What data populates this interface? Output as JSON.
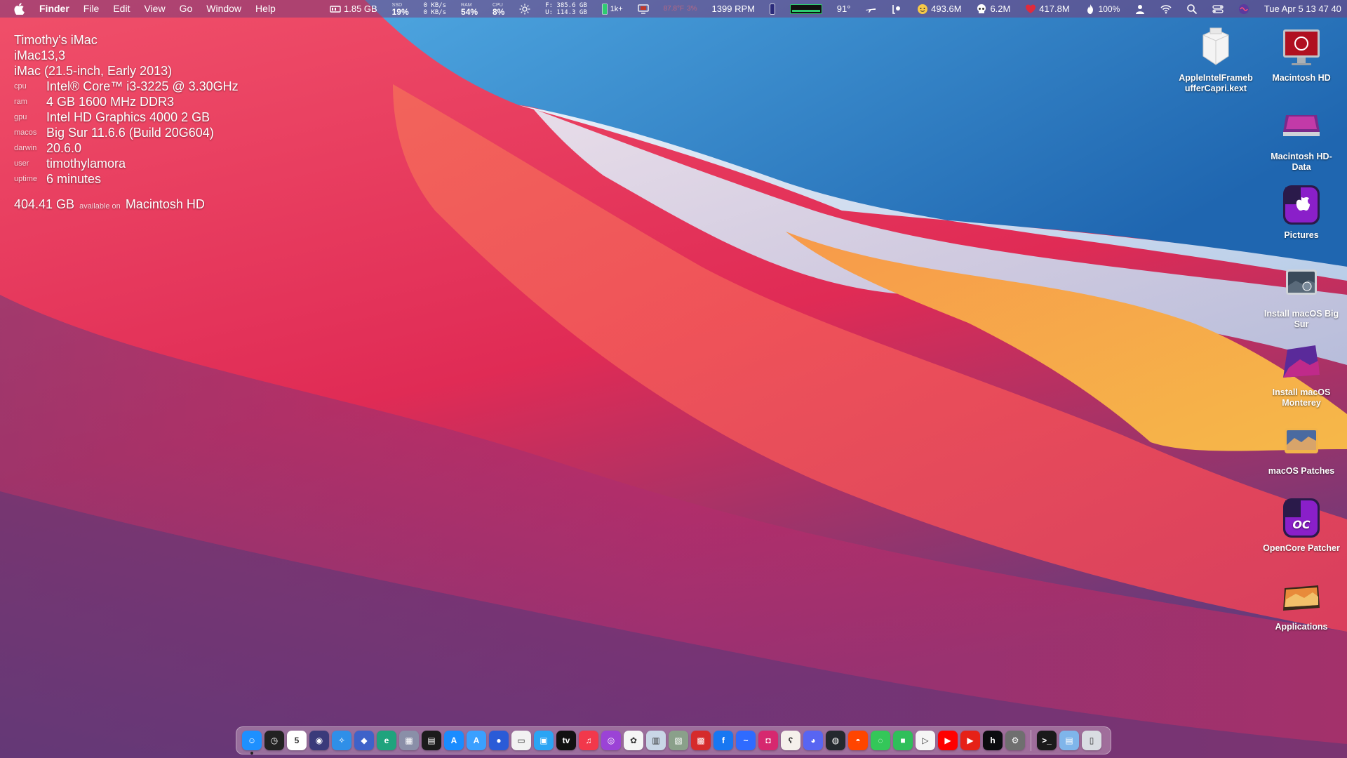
{
  "menubar": {
    "app_name": "Finder",
    "menus": [
      "File",
      "Edit",
      "View",
      "Go",
      "Window",
      "Help"
    ],
    "memory_free": "1.85 GB",
    "ssd_label": "SSD",
    "ssd_value": "19%",
    "net_up": "0 KB/s",
    "net_down": "0 KB/s",
    "ram_label": "RAM",
    "ram_value": "54%",
    "cpu_label": "CPU",
    "cpu_value": "8%",
    "disk_free": "F: 385.6 GB",
    "disk_used": "U: 114.3 GB",
    "battery_badge": "1k+",
    "temp_reading": "87.8°F",
    "temp_pct": "3%",
    "fan_speed": "1399 RPM",
    "temperature": "91°",
    "stat_a": "493.6M",
    "stat_b": "6.2M",
    "stat_c": "417.8M",
    "battery_pct": "100%",
    "clock": "Tue Apr 5  13 47 40",
    "accent_color": "#2ecc71"
  },
  "sysinfo": {
    "name": "Timothy's iMac",
    "model_id": "iMac13,3",
    "model": "iMac (21.5-inch, Early 2013)",
    "rows": [
      {
        "key": "cpu",
        "value": "Intel® Core™ i3-3225 @ 3.30GHz"
      },
      {
        "key": "ram",
        "value": "4 GB 1600 MHz DDR3"
      },
      {
        "key": "gpu",
        "value": "Intel HD Graphics 4000 2 GB"
      },
      {
        "key": "macos",
        "value": "Big Sur 11.6.6 (Build 20G604)"
      },
      {
        "key": "darwin",
        "value": "20.6.0"
      },
      {
        "key": "user",
        "value": "timothylamora"
      },
      {
        "key": "uptime",
        "value": "6 minutes"
      }
    ],
    "disk_amount": "404.41 GB",
    "disk_mid": "available on",
    "disk_name": "Macintosh HD"
  },
  "desktop_icons": [
    {
      "label": "AppleIntelFramebufferCapri.kext",
      "icon": "kext-icon"
    },
    {
      "label": "Macintosh HD",
      "icon": "hard-drive-icon"
    },
    {
      "label": "Macintosh HD-Data",
      "icon": "data-drive-icon"
    },
    {
      "label": "Pictures",
      "icon": "pictures-icon"
    },
    {
      "label": "Install macOS Big Sur",
      "icon": "installer-bigsur-icon"
    },
    {
      "label": "Install macOS Monterey",
      "icon": "installer-monterey-icon"
    },
    {
      "label": "macOS Patches",
      "icon": "patches-icon"
    },
    {
      "label": "OpenCore Patcher",
      "icon": "opencore-icon"
    },
    {
      "label": "Applications",
      "icon": "applications-icon"
    }
  ],
  "dock": {
    "apps": [
      {
        "name": "finder-icon",
        "color": "#1e90ff",
        "glyph": "☺"
      },
      {
        "name": "clock-icon",
        "color": "#222222",
        "glyph": "◷"
      },
      {
        "name": "calendar-icon",
        "color": "#ffffff",
        "glyph": "5"
      },
      {
        "name": "siri-icon",
        "color": "#3a3a7a",
        "glyph": "◉"
      },
      {
        "name": "safari-icon",
        "color": "#2f8fe8",
        "glyph": "✧"
      },
      {
        "name": "utility-icon",
        "color": "#3e62c9",
        "glyph": "◆"
      },
      {
        "name": "edge-icon",
        "color": "#1fa37d",
        "glyph": "e"
      },
      {
        "name": "launchpad-icon",
        "color": "#8a8fa8",
        "glyph": "▦"
      },
      {
        "name": "widgets-icon",
        "color": "#1b1b1b",
        "glyph": "▤"
      },
      {
        "name": "app-store-icon",
        "color": "#1a8cff",
        "glyph": "A"
      },
      {
        "name": "xcode-icon",
        "color": "#3aa0ff",
        "glyph": "A"
      },
      {
        "name": "feedback-icon",
        "color": "#2a5bd7",
        "glyph": "●"
      },
      {
        "name": "apple-card-icon",
        "color": "#f2f2f2",
        "glyph": "▭"
      },
      {
        "name": "screen-icon",
        "color": "#2aa4f4",
        "glyph": "▣"
      },
      {
        "name": "apple-tv-icon",
        "color": "#111111",
        "glyph": "tv"
      },
      {
        "name": "music-icon",
        "color": "#f2384b",
        "glyph": "♫"
      },
      {
        "name": "podcasts-icon",
        "color": "#9b43d6",
        "glyph": "◎"
      },
      {
        "name": "photos-icon",
        "color": "#f5f5f5",
        "glyph": "✿"
      },
      {
        "name": "preview-icon",
        "color": "#c9d6e6",
        "glyph": "▥"
      },
      {
        "name": "image-capture-icon",
        "color": "#8aa08a",
        "glyph": "▧"
      },
      {
        "name": "photo-booth-icon",
        "color": "#d52b2b",
        "glyph": "▩"
      },
      {
        "name": "facebook-icon",
        "color": "#1877f2",
        "glyph": "f"
      },
      {
        "name": "messenger-icon",
        "color": "#2f6bff",
        "glyph": "~"
      },
      {
        "name": "instagram-icon",
        "color": "#d6286f",
        "glyph": "◘"
      },
      {
        "name": "bear-icon",
        "color": "#f5f0eb",
        "glyph": "ʕ"
      },
      {
        "name": "discord-icon",
        "color": "#5865f2",
        "glyph": "◕"
      },
      {
        "name": "github-icon",
        "color": "#24292e",
        "glyph": "◍"
      },
      {
        "name": "reddit-icon",
        "color": "#ff4500",
        "glyph": "◓"
      },
      {
        "name": "messages-icon",
        "color": "#34c759",
        "glyph": "◌"
      },
      {
        "name": "facetime-icon",
        "color": "#2fbf5a",
        "glyph": "■"
      },
      {
        "name": "play-icon",
        "color": "#f5f5f5",
        "glyph": "▷"
      },
      {
        "name": "youtube-icon",
        "color": "#ff0000",
        "glyph": "▶"
      },
      {
        "name": "youtube-alt-icon",
        "color": "#e62117",
        "glyph": "▶"
      },
      {
        "name": "hulu-icon",
        "color": "#0b0c0f",
        "glyph": "h"
      },
      {
        "name": "system-preferences-icon",
        "color": "#6f6f6f",
        "glyph": "⚙"
      }
    ],
    "right_apps": [
      {
        "name": "terminal-icon",
        "color": "#1a1a1a",
        "glyph": ">_"
      },
      {
        "name": "downloads-icon",
        "color": "#7fb5ea",
        "glyph": "▤"
      },
      {
        "name": "trash-icon",
        "color": "#d9dde2",
        "glyph": "▯"
      }
    ]
  }
}
